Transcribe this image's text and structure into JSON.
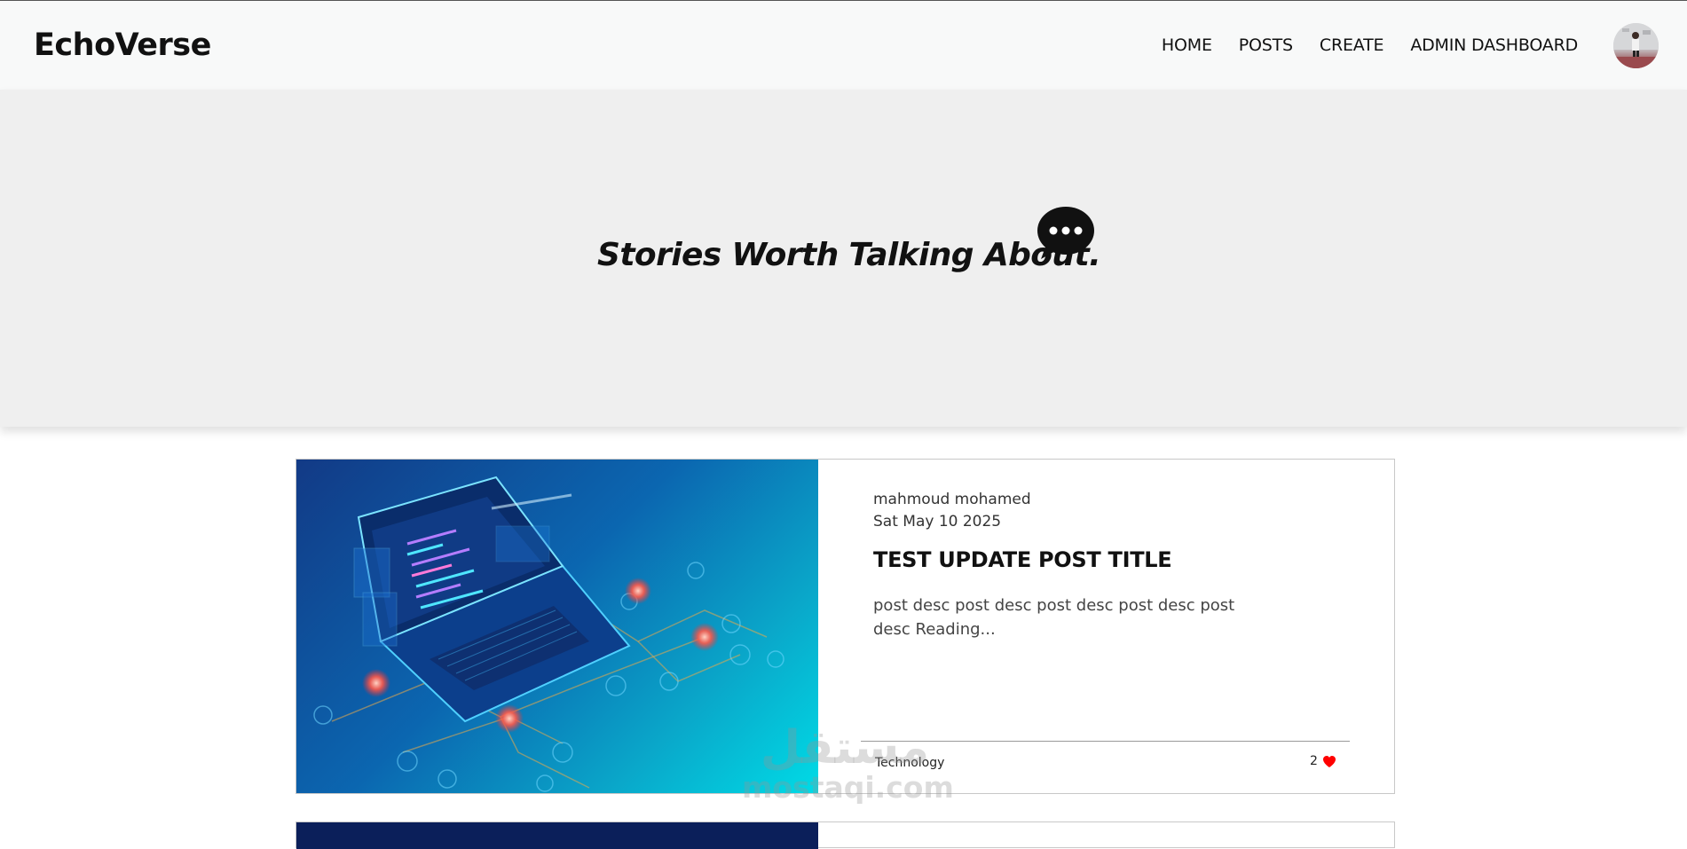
{
  "navbar": {
    "brand": "EchoVerse",
    "links": [
      "HOME",
      "POSTS",
      "CREATE",
      "ADMIN DASHBOARD"
    ],
    "avatar_icon": "user-avatar"
  },
  "hero": {
    "title": "Stories Worth Talking About.",
    "icon": "chat-bubble-icon"
  },
  "posts": [
    {
      "author": "mahmoud mohamed",
      "date": "Sat May 10 2025",
      "title": "TEST UPDATE POST TITLE",
      "description": "post desc post desc post desc post desc post desc Reading...",
      "category": "Technology",
      "likes": "2",
      "like_icon": "heart-icon",
      "like_color": "#ff0000"
    }
  ],
  "watermark": {
    "arabic": "مستقل",
    "latin": "mostaqi.com"
  },
  "colors": {
    "navbar_bg": "#f8f9f9",
    "hero_bg": "#efefef"
  }
}
